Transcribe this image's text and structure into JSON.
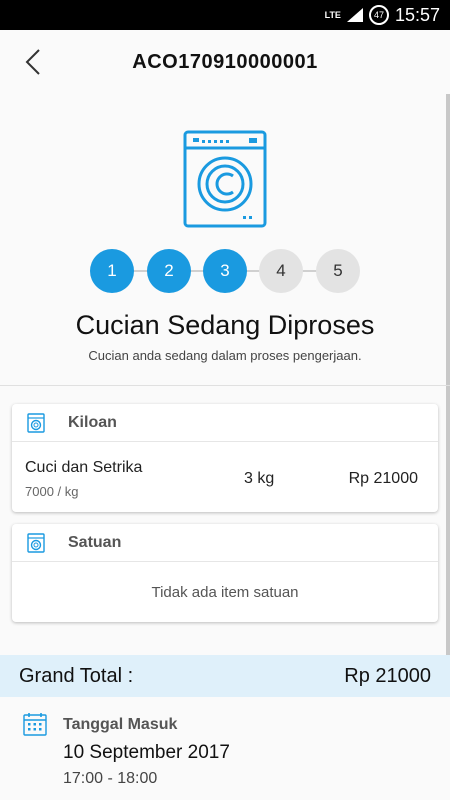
{
  "status_bar": {
    "network": "LTE",
    "battery": "47",
    "time": "15:57"
  },
  "header": {
    "title": "ACO170910000001",
    "back_icon": "chevron-left-icon"
  },
  "progress": {
    "steps": [
      "1",
      "2",
      "3",
      "4",
      "5"
    ],
    "current_step": 3,
    "active_color": "#1a9ae0",
    "inactive_color": "#e3e3e3"
  },
  "status": {
    "title": "Cucian Sedang Diproses",
    "subtitle": "Cucian anda sedang dalam proses pengerjaan."
  },
  "kiloan": {
    "label": "Kiloan",
    "icon": "washing-machine-icon",
    "items": [
      {
        "name": "Cuci dan Setrika",
        "price": "7000 / kg",
        "qty": "3 kg",
        "total": "Rp 21000"
      }
    ]
  },
  "satuan": {
    "label": "Satuan",
    "icon": "washing-machine-icon",
    "empty_text": "Tidak ada item satuan"
  },
  "grand_total": {
    "label": "Grand Total :",
    "value": "Rp 21000",
    "bg_color": "#dff0fa"
  },
  "tanggal_masuk": {
    "label": "Tanggal Masuk",
    "icon": "calendar-icon",
    "date": "10 September 2017",
    "time": "17:00 - 18:00"
  }
}
